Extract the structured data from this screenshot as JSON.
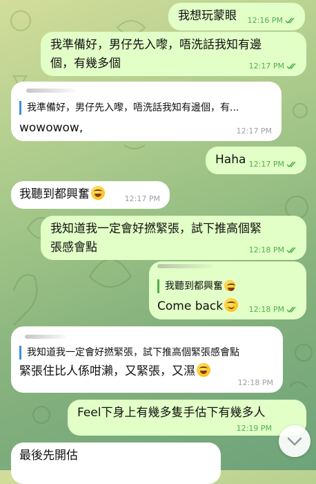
{
  "messages": [
    {
      "id": "m1",
      "type": "outgoing",
      "text": "我想玩蒙眼",
      "time": "12:16 PM"
    },
    {
      "id": "m2",
      "type": "outgoing",
      "text_line1": "我準備好，男仔先入嚟，唔洗話我知有邊",
      "text_line2": "個，有幾多個",
      "time": "12:17 PM"
    },
    {
      "id": "m3",
      "type": "incoming",
      "quote": "我準備好，男仔先入嚟，唔洗話我知有邊個，有...",
      "text": "wowowow,",
      "time": "12:17 PM"
    },
    {
      "id": "m4",
      "type": "outgoing",
      "text": "Haha",
      "time": "12:17 PM"
    },
    {
      "id": "m5",
      "type": "incoming",
      "text": "我聽到都興奮",
      "time": "12:17 PM"
    },
    {
      "id": "m6",
      "type": "outgoing",
      "text_line1": "我知道我一定會好撚緊張，試下推高個緊",
      "text_line2": "張感會點",
      "time": "12:18 PM"
    },
    {
      "id": "m7",
      "type": "outgoing",
      "quote": "我聽到都興奮",
      "text": "Come back",
      "time": "12:18 PM"
    },
    {
      "id": "m8",
      "type": "incoming",
      "quote": "我知道我一定會好撚緊張，試下推高個緊張感會點",
      "text": "緊張住比人係咁瀨，又緊張，又濕",
      "time": "12:18 PM"
    },
    {
      "id": "m9",
      "type": "outgoing",
      "text": "Feel下身上有幾多隻手估下有幾多人",
      "time": "12:19 PM"
    },
    {
      "id": "m10",
      "type": "incoming",
      "text": "最後先開估"
    }
  ],
  "icons": {
    "read_receipt": "double-check-icon",
    "laugh_emoji": "grinning-squinting-face-emoji",
    "wink_emoji": "winking-face-emoji",
    "scroll_down": "chevron-down-icon"
  },
  "colors": {
    "outgoing_bubble": "#e2ffc7",
    "incoming_bubble": "#ffffff",
    "outgoing_time": "#4fae4e",
    "reply_bar": "#3a8fe0"
  }
}
